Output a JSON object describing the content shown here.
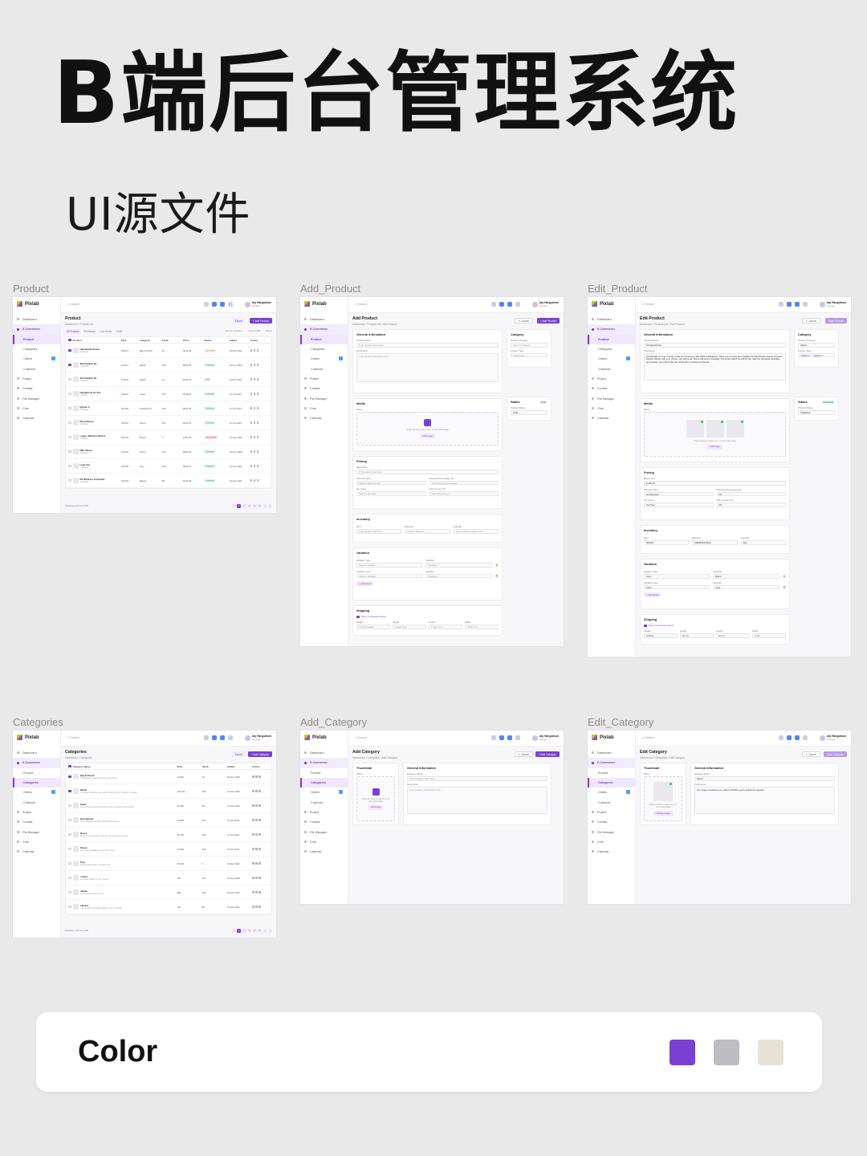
{
  "hero": {
    "title": "B端后台管理系统",
    "subtitle": "UI源文件"
  },
  "panels": {
    "product": "Product",
    "add_product": "Add_Product",
    "edit_product": "Edit_Product",
    "categories": "Categories",
    "add_category": "Add_Category",
    "edit_category": "Edit_Category"
  },
  "app": {
    "logo": "Pixlab",
    "search_placeholder": "Search",
    "user_name": "Jay Hargudson",
    "user_role": "Manager",
    "nav": [
      {
        "label": "Dashboard",
        "kind": "top"
      },
      {
        "label": "E-Commerce",
        "kind": "group"
      },
      {
        "label": "Product",
        "kind": "sub"
      },
      {
        "label": "Categories",
        "kind": "sub"
      },
      {
        "label": "Orders",
        "kind": "sub",
        "badge": true
      },
      {
        "label": "Customer",
        "kind": "sub"
      },
      {
        "label": "Project",
        "kind": "top"
      },
      {
        "label": "Contact",
        "kind": "top"
      },
      {
        "label": "File Manager",
        "kind": "top"
      },
      {
        "label": "Chat",
        "kind": "top"
      },
      {
        "label": "Calendar",
        "kind": "top"
      }
    ]
  },
  "product_list": {
    "title": "Product",
    "crumb": "Dashboard  ›  Product List",
    "export": "Export",
    "add": "+ Add Product",
    "tabs": [
      "All Product",
      "Published",
      "Low Stock",
      "Draft"
    ],
    "search_placeholder": "Search product...",
    "select_date": "Select Date",
    "filters": "Filters",
    "columns": [
      "Product",
      "SKU",
      "Category",
      "Stock",
      "Price",
      "Status",
      "Added",
      "Action"
    ],
    "rows": [
      {
        "name": "Handmade Pouch",
        "variants": "3 Variants",
        "sku": "302012",
        "category": "Bag & Pouch",
        "stock": "10",
        "price": "$121.00",
        "status": "Low Stock",
        "st": "low",
        "added": "29 Dec 2022",
        "checked": true
      },
      {
        "name": "Smartwatch E2",
        "variants": "2 Variants",
        "sku": "302011",
        "category": "Watch",
        "stock": "204",
        "price": "$590.00",
        "status": "Published",
        "st": "pub",
        "added": "24 Dec 2022",
        "checked": true
      },
      {
        "name": "Smartwatch E1",
        "variants": "3 Variants",
        "sku": "302002",
        "category": "Watch",
        "stock": "24",
        "price": "$125.00",
        "status": "Draft",
        "st": "draft",
        "added": "12 Dec 2022",
        "checked": false
      },
      {
        "name": "Headphone G1 Pro",
        "variants": "1 Variant",
        "sku": "301901",
        "category": "Audio",
        "stock": "451",
        "price": "$348.00",
        "status": "Published",
        "st": "pub",
        "added": "21 Oct 2022",
        "checked": false
      },
      {
        "name": "Iphone X",
        "variants": "4 Variants",
        "sku": "301900",
        "category": "Smartphone",
        "stock": "612",
        "price": "$607.00",
        "status": "Published",
        "st": "pub",
        "added": "21 Oct 2022",
        "checked": false
      },
      {
        "name": "Puma Shoes",
        "variants": "3 Variants",
        "sku": "301881",
        "category": "Shoes",
        "stock": "403",
        "price": "$234.00",
        "status": "Published",
        "st": "pub",
        "added": "21 Oct 2022",
        "checked": false
      },
      {
        "name": "Logic+ Wireless Mouse",
        "variants": "1 Variant",
        "sku": "301643",
        "category": "Mouse",
        "stock": "0",
        "price": "$760.00",
        "status": "Out of Stock",
        "st": "out",
        "added": "19 Sep 2022",
        "checked": false
      },
      {
        "name": "Nike Shoes",
        "variants": "3 Variants",
        "sku": "301600",
        "category": "Shoes",
        "stock": "347",
        "price": "$400.00",
        "status": "Published",
        "st": "pub",
        "added": "19 Sep 2022",
        "checked": false
      },
      {
        "name": "Lego Car",
        "variants": "2 Variants",
        "sku": "301555",
        "category": "Toys",
        "stock": "299",
        "price": "$812.00",
        "status": "Published",
        "st": "pub",
        "added": "19 Sep 2022",
        "checked": false
      },
      {
        "name": "PS Wireless Controller",
        "variants": "3 Variants",
        "sku": "301002",
        "category": "Beauty",
        "stock": "38",
        "price": "$123.00",
        "status": "Published",
        "st": "pub",
        "added": "10 Sep 2022",
        "checked": false
      }
    ],
    "showing": "Showing 1-10 from 100",
    "pages": [
      "‹",
      "1",
      "2",
      "3",
      "4",
      "5",
      "...",
      "›"
    ]
  },
  "add_product": {
    "title": "Add Product",
    "crumb": "Dashboard  ›  Product List  ›  Add Product",
    "cancel": "✕ Cancel",
    "save": "+ Add Product",
    "general": "General Information",
    "product_name_label": "Product Name",
    "product_name_ph": "Type product name here...",
    "description_label": "Description",
    "description_ph": "Type product description here...",
    "media": "Media",
    "photo_label": "Photo",
    "drop_text": "Drag and drop image here, or click add image",
    "add_image": "Add Image",
    "pricing": "Pricing",
    "base_price": "Base Price",
    "base_price_ph": "$  Type base price here...",
    "discount_type": "Discount Type",
    "discount_type_ph": "Select a discount type",
    "discount_pct": "Discount Percentage (%)",
    "discount_pct_ph": "Type discount percentage...",
    "tax_class": "Tax Class",
    "tax_class_ph": "Select a tax class",
    "vat": "VAT Amount (%)",
    "vat_ph": "Type VAT amount...",
    "inventory": "Inventory",
    "sku": "SKU",
    "sku_ph": "Type product SKU here...",
    "barcode": "Barcode",
    "barcode_ph": "Product Barcode...",
    "quantity": "Quantity",
    "quantity_ph": "Type product quantity here...",
    "variation": "Variation",
    "variation_type": "Variation Type",
    "variation_type_ph": "Select a variation",
    "variation_label": "Variation",
    "variation_ph": "Variation...",
    "add_variant": "+ Add Variant",
    "shipping": "Shipping",
    "physical": "This is a physical product",
    "weight": "Weight",
    "weight_ph": "Product weight...",
    "height": "Height",
    "height_ph": "Height (cm)...",
    "length": "Length",
    "length_ph": "Length (cm)...",
    "width": "Width",
    "width_ph": "Width (cm)...",
    "category": "Category",
    "product_category": "Product Category",
    "category_ph": "Select a category",
    "product_tags": "Product Tags",
    "tags_ph": "Select tags",
    "status": "Status",
    "status_badge": "Draft",
    "product_status": "Product Status",
    "status_value": "Draft"
  },
  "edit_product": {
    "title": "Edit Product",
    "crumb": "Dashboard  ›  Product List  ›  Edit Product",
    "cancel": "✕ Cancel",
    "save": "Save Product",
    "product_name": "Smartwatch E2",
    "description": "Smartwatch for men women notify you incoming calls, SMS notifications. when you connect the smartphone with Fitness tracker Connect Fitness tracker with your phone, you will never miss a call and a message. The smart watch for will let you read the complete message and answer your phone directly. Great gift for family and friends.",
    "base_price": "$  400.00",
    "discount_type": "No Discount",
    "discount_pct": "0%",
    "tax_class": "Tax Free",
    "vat": "0%",
    "sku": "302002",
    "barcode": "0984939101123",
    "quantity": "124",
    "var1_type": "Color",
    "var1_value": "Black",
    "var2_type": "Color",
    "var2_value": "Gray",
    "weight": "0.25 kg",
    "height": "10 cm",
    "length": "10 cm",
    "width": "7 cm",
    "category_value": "Watch",
    "tag1": "Watch ✕",
    "tag2": "Gadget ✕",
    "status_badge": "Published",
    "status_value": "Published",
    "drop_text": "Drag and drop image here, or click add image",
    "add_image": "Add Image"
  },
  "categories": {
    "title": "Categories",
    "crumb": "Dashboard  ›  Categories",
    "export": "Export",
    "add": "+ Add Category",
    "columns": [
      "Category Name",
      "Sold",
      "Stock",
      "Added",
      "Action"
    ],
    "rows": [
      {
        "name": "Bag & Pouch",
        "desc": "Great fashion, great selections, great prices.",
        "sold": "10,981",
        "stock": "10",
        "added": "29 Dec 2022",
        "checked": true
      },
      {
        "name": "Watch",
        "desc": "Our range of watches are perfect whether you're looking to upgrade.",
        "sold": "129,543",
        "stock": "204",
        "added": "24 Dec 2022",
        "checked": true
      },
      {
        "name": "Audio",
        "desc": "Get top-range bluetooth devices to listen anywhere and anytime.",
        "sold": "12,000",
        "stock": "98",
        "added": "12 Dec 2022",
        "checked": false
      },
      {
        "name": "Smartphone",
        "desc": "Our smartphone provides full-featured devices.",
        "sold": "24,800",
        "stock": "501",
        "added": "21 Oct 2022",
        "checked": false
      },
      {
        "name": "Shoes",
        "desc": "Whatever your activity needs are, we've got you covered.",
        "sold": "48,700",
        "stock": "500",
        "added": "21 Oct 2022",
        "checked": false
      },
      {
        "name": "Mouse",
        "desc": "Get a mouse suitable for any desk setup.",
        "sold": "23,000",
        "stock": "610",
        "added": "21 Oct 2022",
        "checked": false
      },
      {
        "name": "Toys",
        "desc": "Get the perfect gift for the little ones.",
        "sold": "78,000",
        "stock": "0",
        "added": "19 Sep 2022",
        "checked": false
      },
      {
        "name": "Lenses",
        "desc": "Get better lenses for your camera.",
        "sold": "120",
        "stock": "347",
        "added": "19 Sep 2022",
        "checked": false
      },
      {
        "name": "Games",
        "desc": "Get the perfect game for you.",
        "sold": "800",
        "stock": "299",
        "added": "19 Sep 2022",
        "checked": false
      },
      {
        "name": "Camera",
        "desc": "Find cameras with great quality for you to capture.",
        "sold": "123",
        "stock": "98",
        "added": "10 Sep 2022",
        "checked": false
      }
    ],
    "showing": "Showing 1-10 from 100"
  },
  "add_category": {
    "title": "Add Category",
    "crumb": "Dashboard  ›  Categories  ›  Add Category",
    "cancel": "✕ Cancel",
    "save": "+ Add Category",
    "thumbnail": "Thumbnail",
    "photo": "Photo",
    "drop_text": "Drag and drop image here, or click add image",
    "add_image": "Add Image",
    "general": "General Information",
    "name_label": "Category Name",
    "name_ph": "Type category name here...",
    "desc_label": "Description",
    "desc_ph": "Type category description here..."
  },
  "edit_category": {
    "title": "Edit Category",
    "crumb": "Dashboard  ›  Categories  ›  Edit Category",
    "cancel": "✕ Cancel",
    "save": "Save Category",
    "drop_text": "Drag and drop image here, or click add image",
    "change_image": "Change Image",
    "name_value": "Watch",
    "desc_value": "Our range of watches are perfect whether you're looking to upgrade."
  },
  "color_card": {
    "label": "Color",
    "swatches": [
      "#7b3fd1",
      "#bdbdc2",
      "#e6e2d6"
    ]
  }
}
